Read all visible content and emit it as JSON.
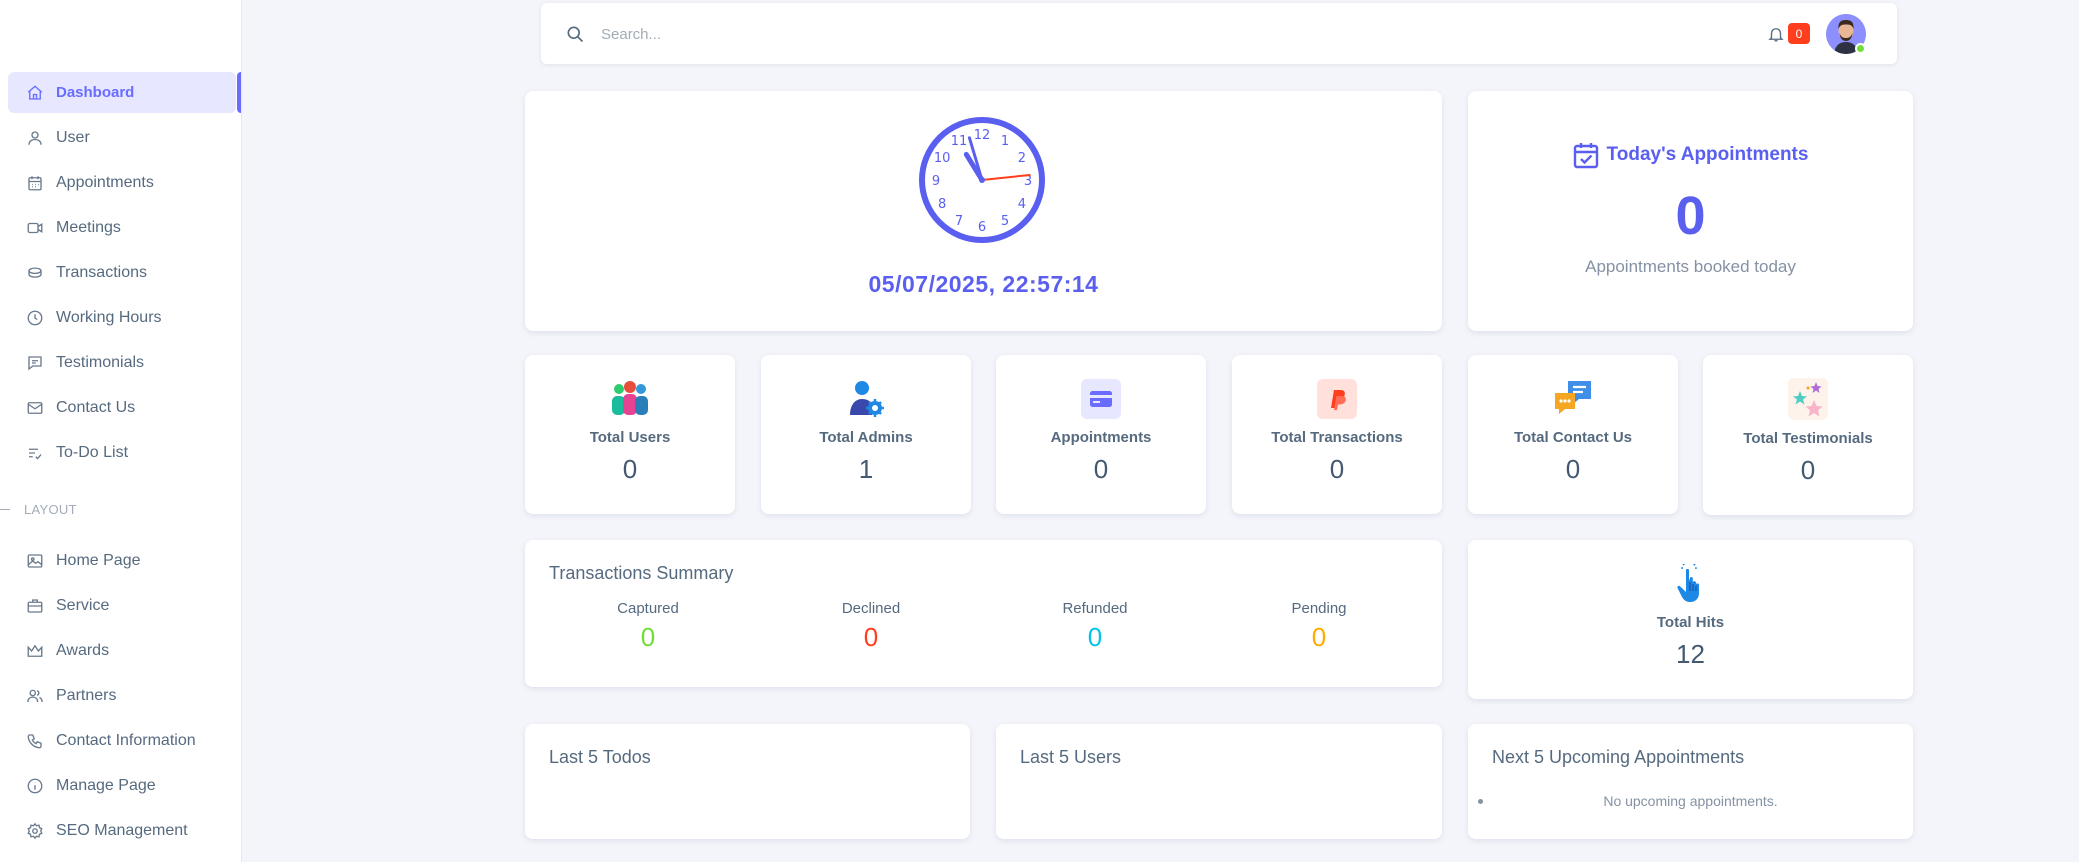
{
  "sidebar": {
    "menu": [
      {
        "label": "Dashboard",
        "icon": "home-icon",
        "active": true
      },
      {
        "label": "User",
        "icon": "user-icon"
      },
      {
        "label": "Appointments",
        "icon": "calendar-icon"
      },
      {
        "label": "Meetings",
        "icon": "video-icon"
      },
      {
        "label": "Transactions",
        "icon": "coins-icon"
      },
      {
        "label": "Working Hours",
        "icon": "clock-icon"
      },
      {
        "label": "Testimonials",
        "icon": "message-icon"
      },
      {
        "label": "Contact Us",
        "icon": "mail-icon"
      },
      {
        "label": "To-Do List",
        "icon": "list-check-icon"
      }
    ],
    "section_header": "LAYOUT",
    "layout_menu": [
      {
        "label": "Home Page",
        "icon": "image-icon"
      },
      {
        "label": "Service",
        "icon": "briefcase-icon"
      },
      {
        "label": "Awards",
        "icon": "crown-icon"
      },
      {
        "label": "Partners",
        "icon": "users-icon"
      },
      {
        "label": "Contact Information",
        "icon": "phone-icon"
      },
      {
        "label": "Manage Page",
        "icon": "info-icon"
      },
      {
        "label": "SEO Management",
        "icon": "gear-icon"
      }
    ]
  },
  "navbar": {
    "search_placeholder": "Search...",
    "notification_count": "0"
  },
  "clock": {
    "datetime": "05/07/2025, 22:57:14",
    "numbers": [
      "12",
      "1",
      "2",
      "3",
      "4",
      "5",
      "6",
      "7",
      "8",
      "9",
      "10",
      "11"
    ],
    "time": {
      "hour": 22,
      "minute": 57,
      "second": 14
    },
    "color": "#5a5ff0"
  },
  "appointments_today": {
    "title": "Today's Appointments",
    "count": "0",
    "subtitle": "Appointments booked today"
  },
  "stats": [
    {
      "label": "Total Users",
      "value": "0",
      "icon": "users-group-icon"
    },
    {
      "label": "Total Admins",
      "value": "1",
      "icon": "admin-gear-icon"
    },
    {
      "label": "Appointments",
      "value": "0",
      "icon": "credit-card-icon"
    },
    {
      "label": "Total Transactions",
      "value": "0",
      "icon": "paypal-icon"
    },
    {
      "label": "Total Contact Us",
      "value": "0",
      "icon": "chat-bubbles-icon"
    },
    {
      "label": "Total Testimonials",
      "value": "0",
      "icon": "stars-icon"
    }
  ],
  "transactions_summary": {
    "title": "Transactions Summary",
    "items": [
      {
        "label": "Captured",
        "value": "0",
        "color": "#71dd37"
      },
      {
        "label": "Declined",
        "value": "0",
        "color": "#ff3e1d"
      },
      {
        "label": "Refunded",
        "value": "0",
        "color": "#03c3ec"
      },
      {
        "label": "Pending",
        "value": "0",
        "color": "#ffab00"
      }
    ]
  },
  "hits": {
    "label": "Total Hits",
    "value": "12",
    "icon": "pointer-hand-icon"
  },
  "lists": {
    "todos_title": "Last 5 Todos",
    "users_title": "Last 5 Users",
    "upcoming_title": "Next 5 Upcoming Appointments",
    "upcoming_empty": "No upcoming appointments."
  },
  "colors": {
    "primary": "#696cff",
    "background": "#f4f5fb"
  }
}
